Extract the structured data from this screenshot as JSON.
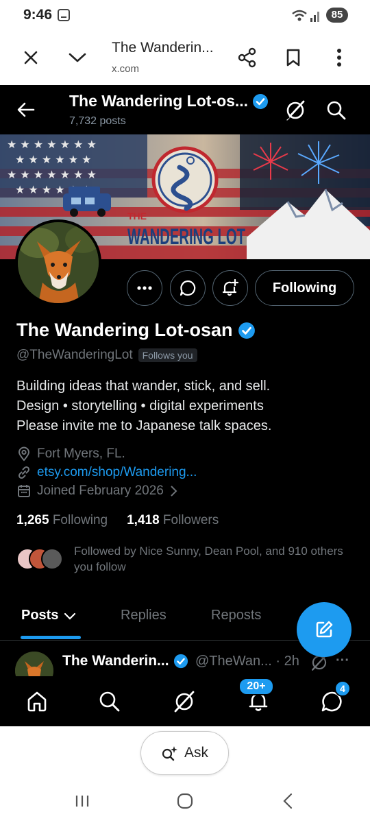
{
  "status_bar": {
    "time": "9:46",
    "battery": "85"
  },
  "browser": {
    "title": "The Wanderin...",
    "domain": "x.com"
  },
  "topbar": {
    "name": "The Wandering Lot-os...",
    "posts_count": "7,732 posts"
  },
  "banner": {
    "line1": "THE",
    "line2": "WANDERING LOT"
  },
  "profile": {
    "display_name": "The Wandering Lot-osan",
    "handle": "@TheWanderingLot",
    "follows_you": "Follows you",
    "bio": [
      "Building ideas that wander, stick, and sell.",
      "Design • storytelling • digital experiments",
      "Please invite me to Japanese talk spaces."
    ],
    "location": "Fort Myers, FL.",
    "website": "etsy.com/shop/Wandering...",
    "joined": "Joined February 2026",
    "following_count": "1,265",
    "following_label": "Following",
    "followers_count": "1,418",
    "followers_label": "Followers",
    "followed_by": "Followed by Nice Sunny, Dean Pool, and 910 others you follow"
  },
  "actions": {
    "following_button": "Following"
  },
  "tabs": [
    "Posts",
    "Replies",
    "Reposts"
  ],
  "post": {
    "name": "The Wanderin...",
    "handle": "@TheWan... · 2h",
    "more": "···"
  },
  "nav": {
    "notifications_badge": "20+",
    "messages_badge": "4"
  },
  "ask_button": "Ask",
  "colors": {
    "accent": "#1d9bf0",
    "background": "#000000",
    "muted": "#71767b"
  },
  "icons": [
    "close-icon",
    "chevron-down-icon",
    "share-icon",
    "bookmark-icon",
    "more-vertical-icon",
    "back-arrow-icon",
    "verified-badge-icon",
    "grok-icon",
    "search-icon",
    "more-icon",
    "message-icon",
    "notification-bell-plus-icon",
    "location-icon",
    "link-icon",
    "calendar-icon",
    "chevron-right-icon",
    "compose-icon",
    "home-icon",
    "bell-icon",
    "messages-icon",
    "ask-sparkle-icon"
  ]
}
